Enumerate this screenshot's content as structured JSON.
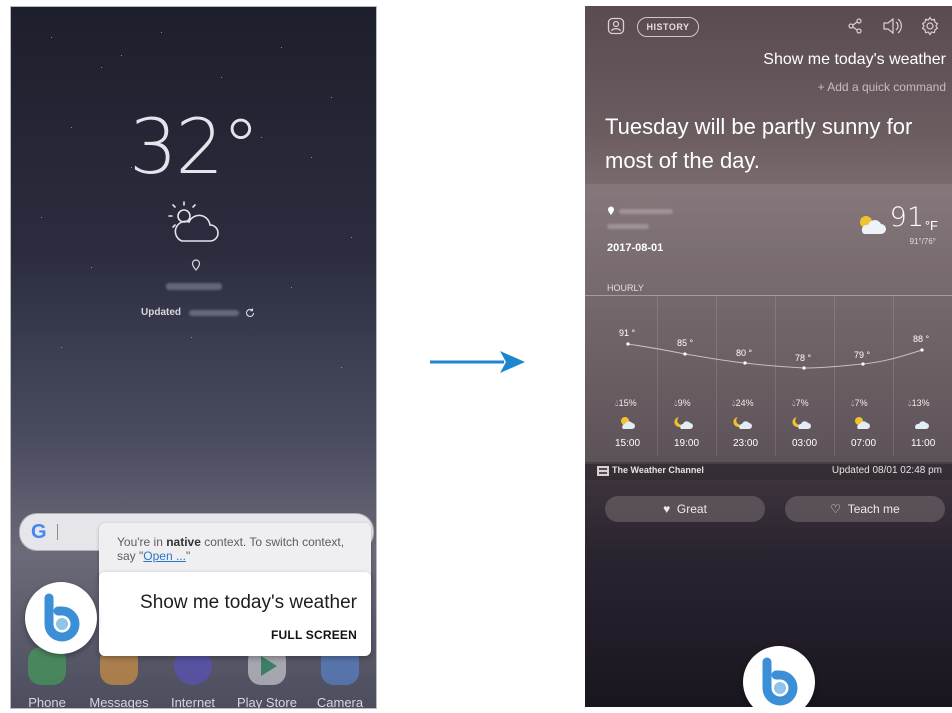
{
  "left_screen": {
    "lockscreen": {
      "temperature": "32°",
      "updated_label": "Updated"
    },
    "google_search": {
      "logo": "G"
    },
    "context_card": {
      "prefix": "You're in ",
      "context_word": "native",
      "suffix": " context. To switch context, say \"",
      "open_link": "Open ...",
      "end": "\""
    },
    "command_card": {
      "command": "Show me today's weather",
      "full_screen_button": "FULL SCREEN"
    },
    "dock": [
      {
        "label": "Phone",
        "icon": "phone-icon",
        "color": "#3fae5a"
      },
      {
        "label": "Messages",
        "icon": "messages-icon",
        "color": "#f1a33a"
      },
      {
        "label": "Internet",
        "icon": "internet-icon",
        "color": "#5b52d4"
      },
      {
        "label": "Play Store",
        "icon": "play-store-icon",
        "color": "#e9e9ee"
      },
      {
        "label": "Camera",
        "icon": "camera-icon",
        "color": "#5a8ee6"
      }
    ]
  },
  "right_screen": {
    "history_button": "HISTORY",
    "query": "Show me today's weather",
    "quick_command": "+ Add a quick command",
    "answer": "Tuesday will be partly sunny for most of the day.",
    "weather": {
      "date": "2017-08-01",
      "current_temp": "91",
      "unit": "°F",
      "hi_lo": "91°/76°",
      "hourly_label": "HOURLY",
      "hours": [
        {
          "time": "15:00",
          "temp": "91 °",
          "precip": "15%"
        },
        {
          "time": "19:00",
          "temp": "85 °",
          "precip": "9%"
        },
        {
          "time": "23:00",
          "temp": "80 °",
          "precip": "24%"
        },
        {
          "time": "03:00",
          "temp": "78 °",
          "precip": "7%"
        },
        {
          "time": "07:00",
          "temp": "79 °",
          "precip": "7%"
        },
        {
          "time": "11:00",
          "temp": "88 °",
          "precip": "13%"
        }
      ],
      "source": "The Weather Channel",
      "updated": "Updated  08/01 02:48 pm"
    },
    "feedback": {
      "great": "Great",
      "teach": "Teach me"
    }
  },
  "colors": {
    "bixby_blue": "#3a8fd6",
    "arrow_blue": "#1c86cf"
  }
}
